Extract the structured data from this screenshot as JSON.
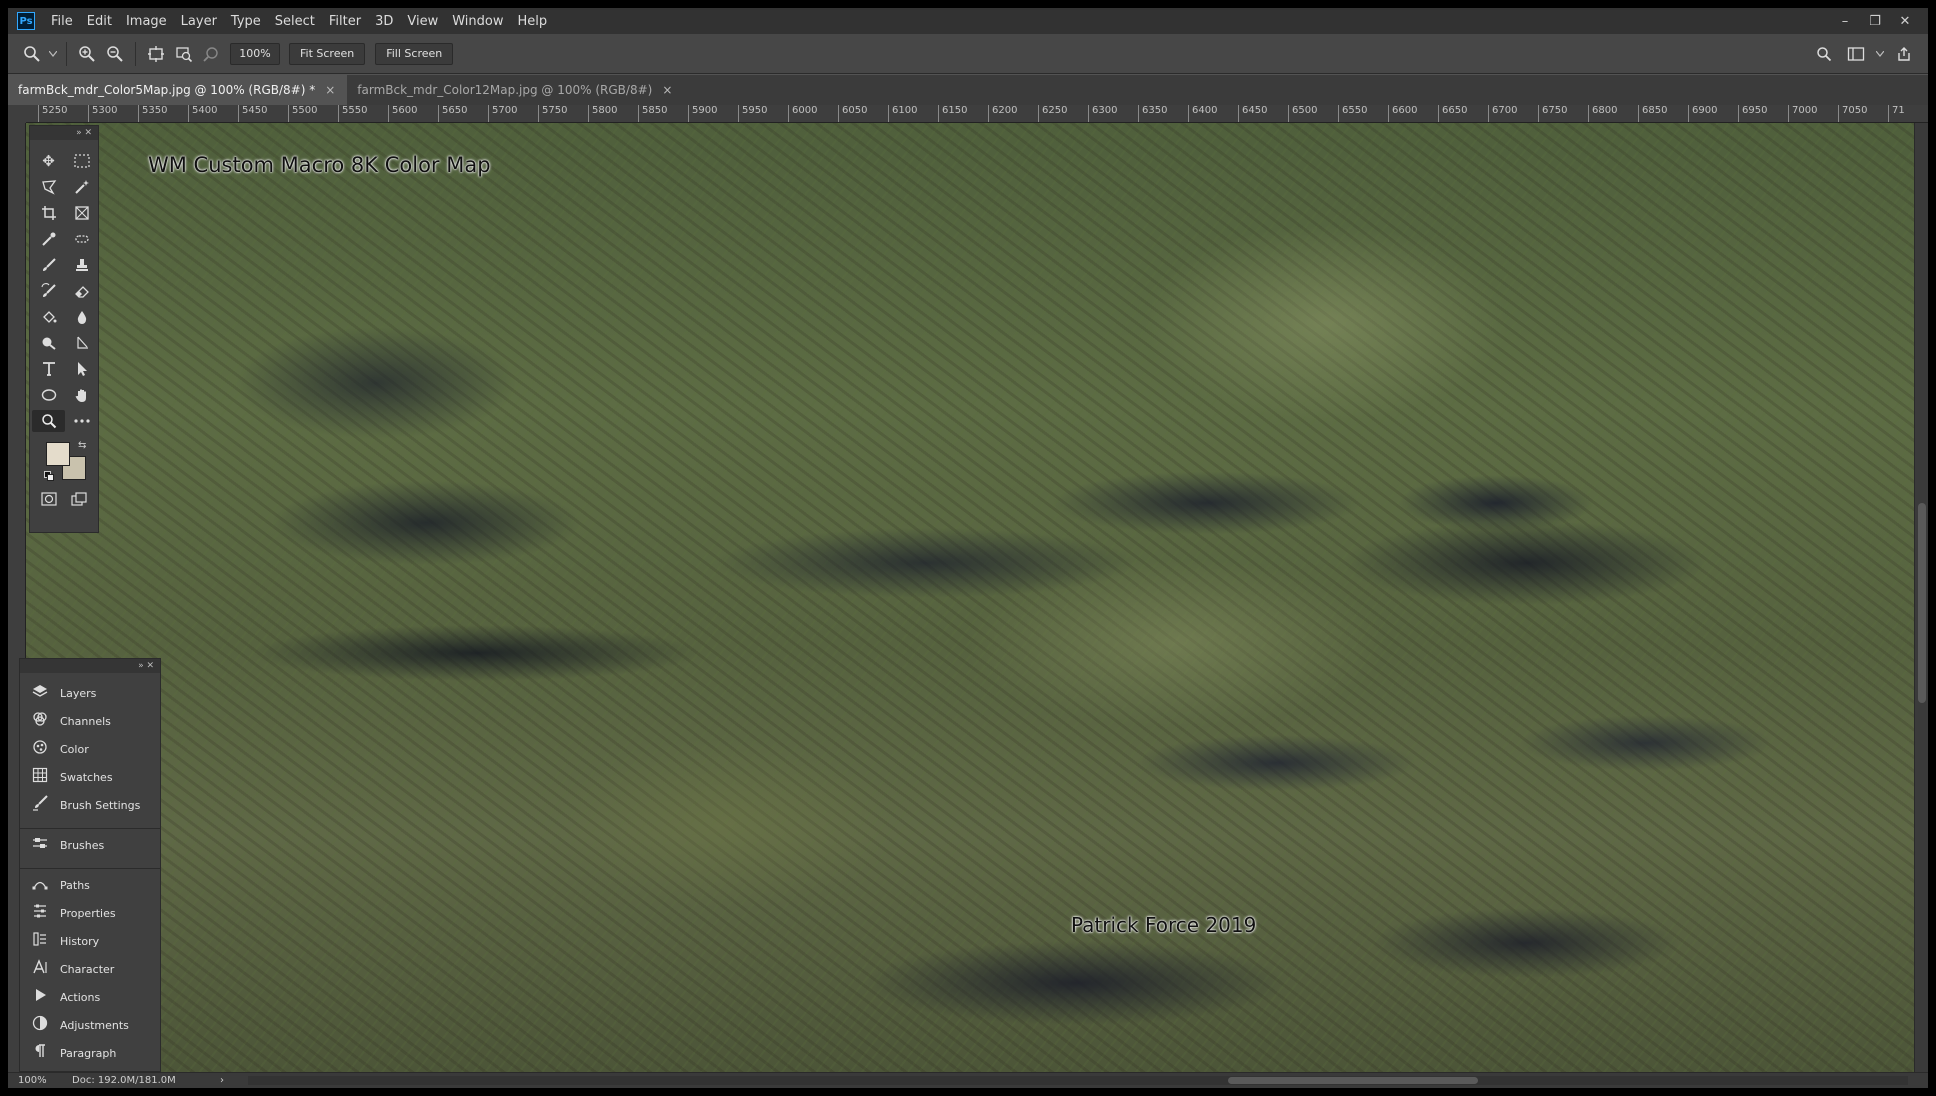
{
  "app": {
    "logo": "Ps"
  },
  "menu": [
    "File",
    "Edit",
    "Image",
    "Layer",
    "Type",
    "Select",
    "Filter",
    "3D",
    "View",
    "Window",
    "Help"
  ],
  "window_controls": {
    "minimize": "–",
    "restore": "❐",
    "close": "✕"
  },
  "options": {
    "zoom_value": "100%",
    "fit_screen": "Fit Screen",
    "fill_screen": "Fill Screen"
  },
  "tabs": [
    {
      "label": "farmBck_mdr_Color5Map.jpg @ 100% (RGB/8#) *",
      "close": "×"
    },
    {
      "label": "farmBck_mdr_Color12Map.jpg @ 100% (RGB/8#)",
      "close": "×"
    }
  ],
  "ruler_labels": [
    "5250",
    "5300",
    "5350",
    "5400",
    "5450",
    "5500",
    "5550",
    "5600",
    "5650",
    "5700",
    "5750",
    "5800",
    "5850",
    "5900",
    "5950",
    "6000",
    "6050",
    "6100",
    "6150",
    "6200",
    "6250",
    "6300",
    "6350",
    "6400",
    "6450",
    "6500",
    "6550",
    "6600",
    "6650",
    "6700",
    "6750",
    "6800",
    "6850",
    "6900",
    "6950",
    "7000",
    "7050",
    "71"
  ],
  "canvas": {
    "label_top": "WM Custom Macro 8K Color Map",
    "label_bottom": "Patrick Force 2019"
  },
  "colors": {
    "foreground": "#e4dccb",
    "background": "#c9c2ad"
  },
  "dock": {
    "group1": [
      {
        "label": "Layers",
        "icon": "layers-icon"
      },
      {
        "label": "Channels",
        "icon": "channels-icon"
      },
      {
        "label": "Color",
        "icon": "color-icon"
      },
      {
        "label": "Swatches",
        "icon": "swatches-icon"
      },
      {
        "label": "Brush Settings",
        "icon": "brush-settings-icon"
      }
    ],
    "group2": [
      {
        "label": "Brushes",
        "icon": "brushes-icon"
      }
    ],
    "group3": [
      {
        "label": "Paths",
        "icon": "paths-icon"
      },
      {
        "label": "Properties",
        "icon": "properties-icon"
      },
      {
        "label": "History",
        "icon": "history-icon"
      },
      {
        "label": "Character",
        "icon": "character-icon"
      },
      {
        "label": "Actions",
        "icon": "actions-icon"
      },
      {
        "label": "Adjustments",
        "icon": "adjustments-icon"
      },
      {
        "label": "Paragraph",
        "icon": "paragraph-icon"
      }
    ]
  },
  "status": {
    "zoom": "100%",
    "doc": "Doc: 192.0M/181.0M",
    "arrow": "›"
  }
}
